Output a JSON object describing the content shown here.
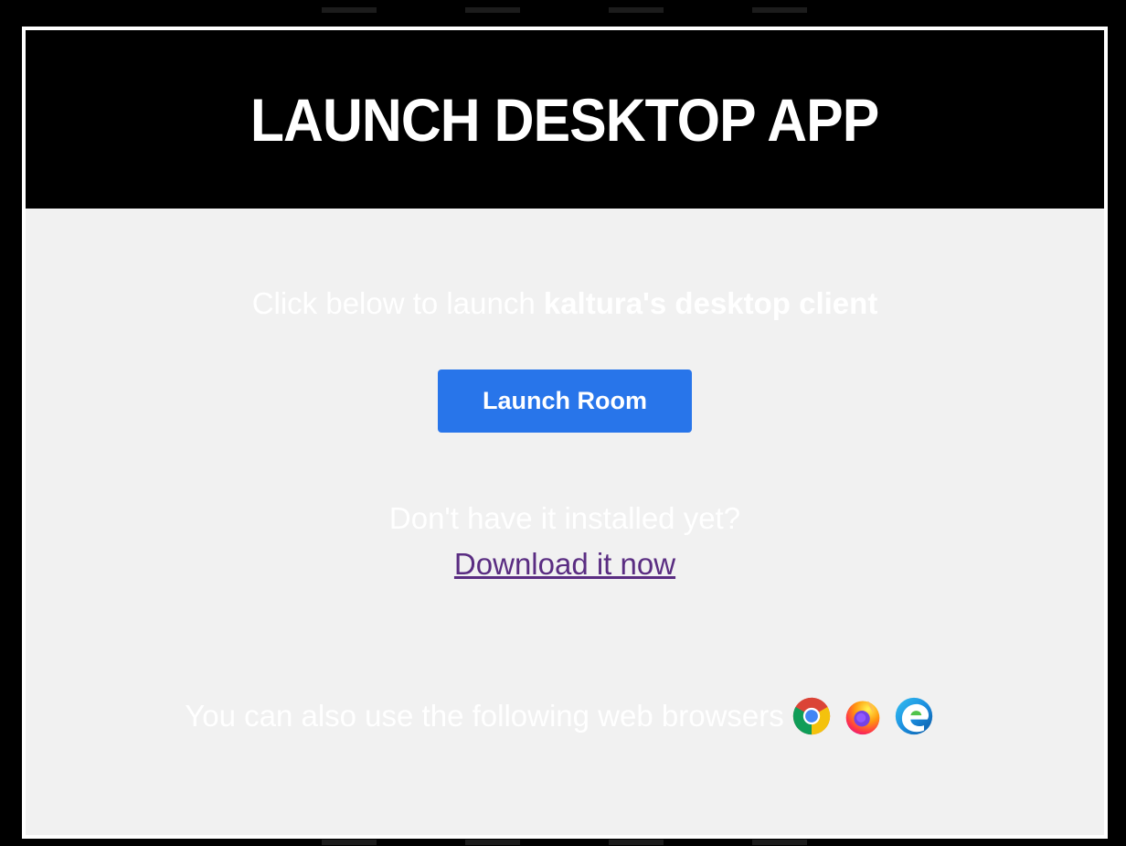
{
  "header": {
    "title": "LAUNCH DESKTOP APP"
  },
  "launch": {
    "prefix": "Click below to launch ",
    "client_name": "kaltura's desktop client",
    "button_label": "Launch Room"
  },
  "install": {
    "question": "Don't have it installed yet?",
    "download_link": "Download it now"
  },
  "browsers": {
    "text": "You can also use the following web browsers",
    "icons": [
      "chrome-icon",
      "firefox-icon",
      "edge-icon"
    ]
  },
  "colors": {
    "background": "#000000",
    "panel": "#f1f1f1",
    "button": "#2875ea",
    "link": "#5a2d82"
  }
}
